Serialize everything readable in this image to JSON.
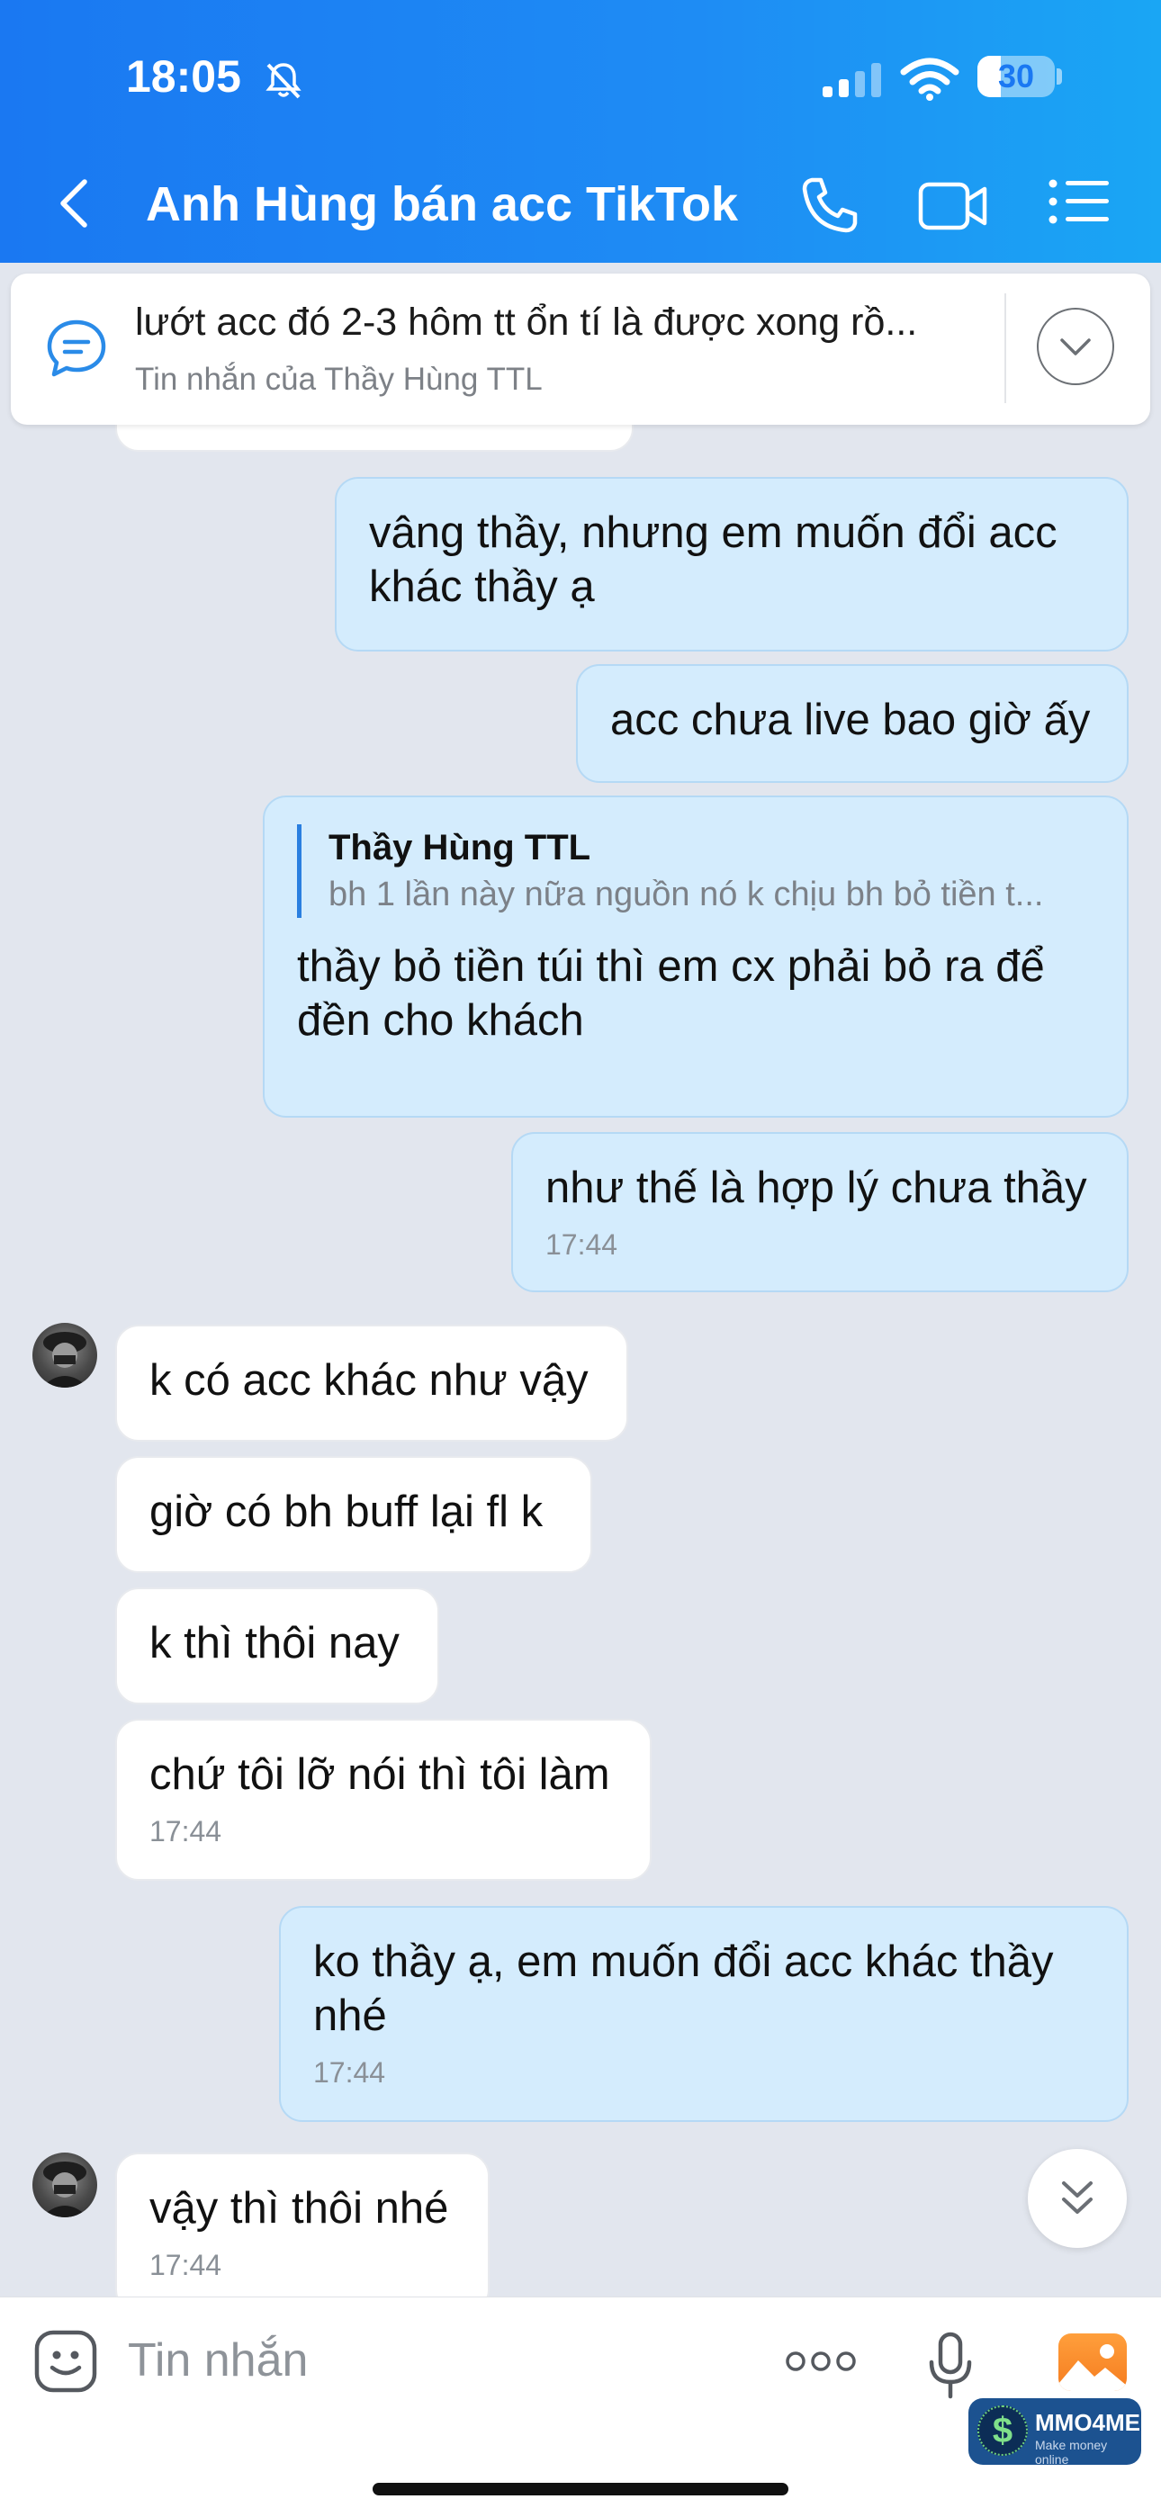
{
  "status_bar": {
    "time": "18:05",
    "battery": "30",
    "battery_level": 0.3
  },
  "header": {
    "title": "Anh Hùng bán acc TikTok"
  },
  "pinned": {
    "text": "lướt acc đó 2-3 hôm tt ổn tí là được xong rồ...",
    "subtitle": "Tin nhắn của Thầy Hùng TTL"
  },
  "messages": [
    {
      "direction": "out",
      "text": "vâng thầy, nhưng em muốn đổi acc khác thầy ạ"
    },
    {
      "direction": "out",
      "text": "acc chưa live bao giờ ấy"
    },
    {
      "direction": "out",
      "quote_name": "Thầy Hùng TTL",
      "quote_text": "bh 1 lần này nữa nguồn nó k chịu bh bỏ tiền t...",
      "text": "thầy bỏ tiền túi thì em cx phải bỏ ra để đền cho khách"
    },
    {
      "direction": "out",
      "text": "như thế là hợp lý chưa thầy",
      "time": "17:44"
    },
    {
      "direction": "in",
      "text": "k có acc khác như vậy"
    },
    {
      "direction": "in",
      "text": "giờ có bh buff lại fl k"
    },
    {
      "direction": "in",
      "text": "k thì thôi nay"
    },
    {
      "direction": "in",
      "text": "chứ tôi lỡ nói thì tôi làm",
      "time": "17:44"
    },
    {
      "direction": "out",
      "text": "ko thầy ạ, em muốn đổi acc khác thầy nhé",
      "time": "17:44"
    },
    {
      "direction": "in",
      "text": "vậy thì thôi nhé",
      "time": "17:44"
    }
  ],
  "input": {
    "placeholder": "Tin nhắn"
  },
  "watermark": {
    "brand": "MMO4ME",
    "tagline": "Make money online"
  },
  "colors": {
    "header": "#1e8cf4",
    "outgoing_bubble": "#d4ecfd",
    "incoming_bubble": "#ffffff",
    "background": "#e2e6ee"
  }
}
